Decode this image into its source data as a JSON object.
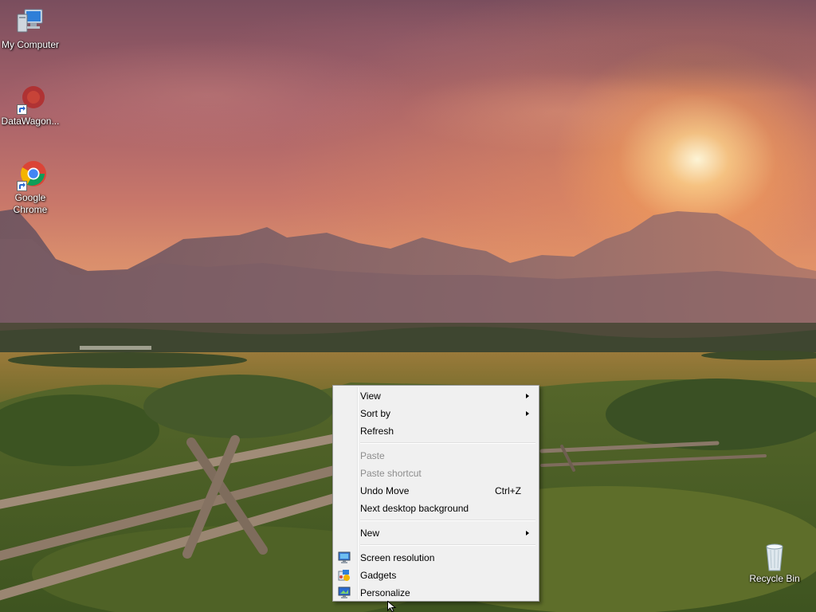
{
  "desktop": {
    "icons": [
      {
        "label": "My Computer",
        "icon": "computer-icon"
      },
      {
        "label": "DataWagon...",
        "icon": "datawagon-shortcut-icon"
      },
      {
        "label": "Google Chrome",
        "icon": "chrome-icon"
      },
      {
        "label": "Recycle Bin",
        "icon": "recycle-bin-icon"
      }
    ]
  },
  "context_menu": {
    "items": [
      {
        "label": "View",
        "has_submenu": true
      },
      {
        "label": "Sort by",
        "has_submenu": true
      },
      {
        "label": "Refresh"
      },
      {
        "label": "Paste",
        "disabled": true
      },
      {
        "label": "Paste shortcut",
        "disabled": true
      },
      {
        "label": "Undo Move",
        "shortcut": "Ctrl+Z"
      },
      {
        "label": "Next desktop background"
      },
      {
        "label": "New",
        "has_submenu": true
      },
      {
        "label": "Screen resolution",
        "icon": "screen-resolution-icon"
      },
      {
        "label": "Gadgets",
        "icon": "gadgets-icon"
      },
      {
        "label": "Personalize",
        "icon": "personalize-icon"
      }
    ]
  },
  "colors": {
    "menu_background": "#f0f0f0",
    "menu_border": "#979797",
    "disabled_text": "#8d8d8d"
  }
}
